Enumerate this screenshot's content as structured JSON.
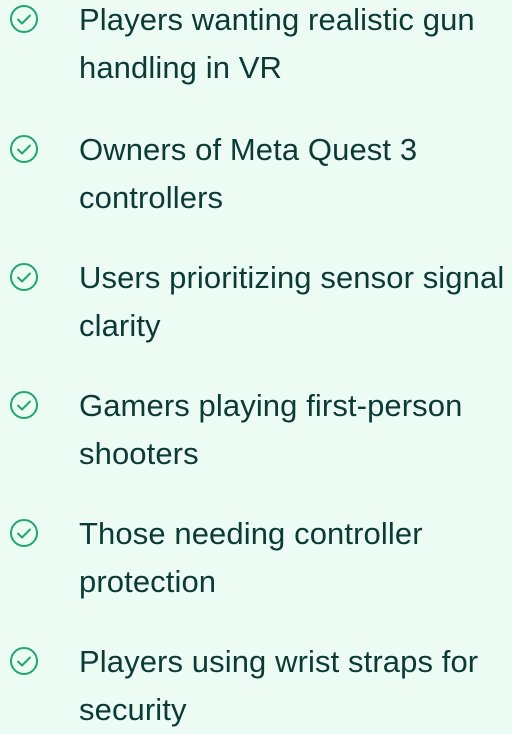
{
  "list": {
    "items": [
      {
        "label": "Players wanting realistic gun handling in VR",
        "icon": "check-circle-icon"
      },
      {
        "label": "Owners of Meta Quest 3 controllers",
        "icon": "check-circle-icon"
      },
      {
        "label": "Users prioritizing sensor signal clarity",
        "icon": "check-circle-icon"
      },
      {
        "label": "Gamers playing first-person shooters",
        "icon": "check-circle-icon"
      },
      {
        "label": "Those needing controller protection",
        "icon": "check-circle-icon"
      },
      {
        "label": "Players using wrist straps for security",
        "icon": "check-circle-icon"
      }
    ],
    "icon_color": "#21a86f",
    "text_color": "#0c3a34",
    "background": "#ecfbf4"
  }
}
